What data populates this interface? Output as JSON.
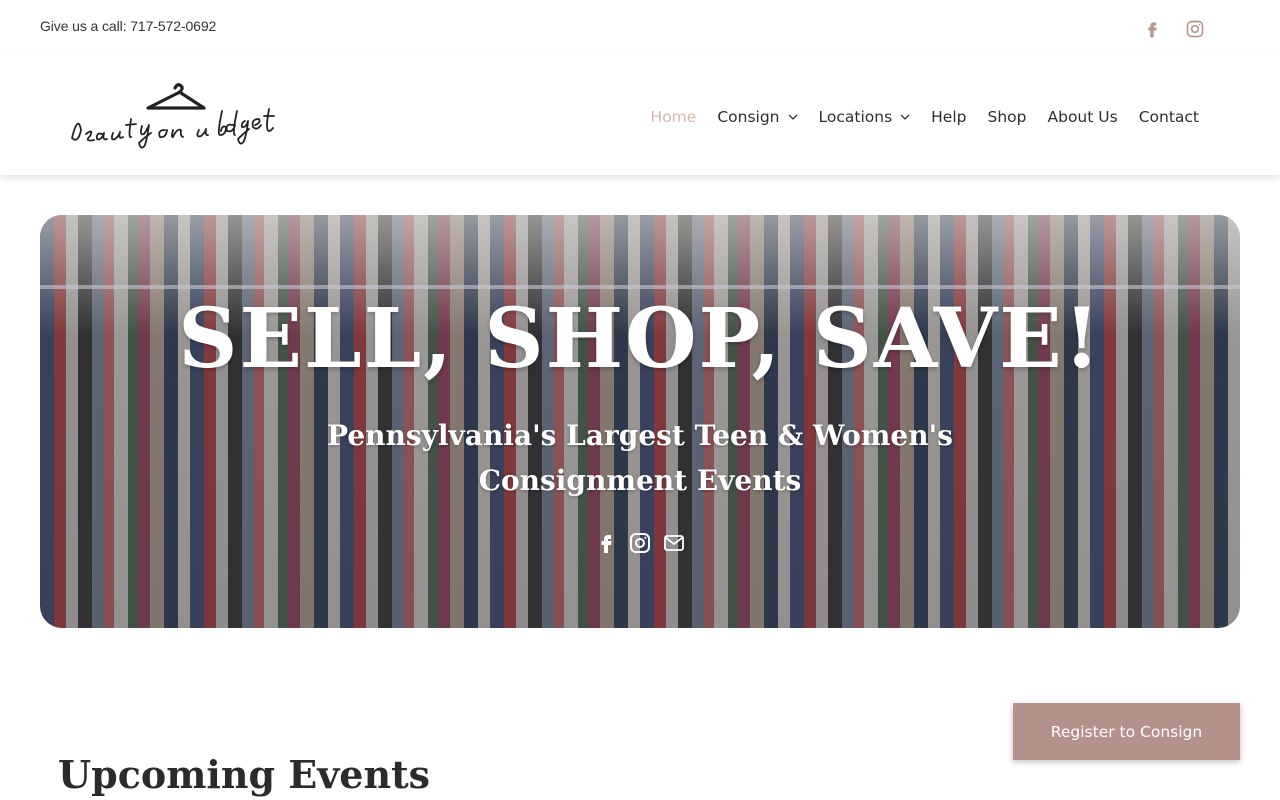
{
  "topbar": {
    "call_text": "Give us a call: 717-572-0692",
    "social": [
      {
        "icon": "facebook-icon"
      },
      {
        "icon": "instagram-icon"
      }
    ]
  },
  "header": {
    "logo_text": "beauty on budget",
    "nav": [
      {
        "label": "Home",
        "active": true,
        "dropdown": false
      },
      {
        "label": "Consign",
        "active": false,
        "dropdown": true
      },
      {
        "label": "Locations",
        "active": false,
        "dropdown": true
      },
      {
        "label": "Help",
        "active": false,
        "dropdown": false
      },
      {
        "label": "Shop",
        "active": false,
        "dropdown": false
      },
      {
        "label": "About Us",
        "active": false,
        "dropdown": false
      },
      {
        "label": "Contact",
        "active": false,
        "dropdown": false
      }
    ]
  },
  "hero": {
    "title": "SELL, SHOP, SAVE!",
    "subtitle": "Pennsylvania's Largest Teen & Women's Consignment Events",
    "icons": [
      "facebook-icon",
      "instagram-icon",
      "email-icon"
    ]
  },
  "main": {
    "section_title": "Upcoming Events"
  },
  "cta": {
    "register_label": "Register to Consign"
  },
  "colors": {
    "accent": "#b5918b",
    "active_nav": "#d9b6b0",
    "social_icon": "#b9968f"
  }
}
